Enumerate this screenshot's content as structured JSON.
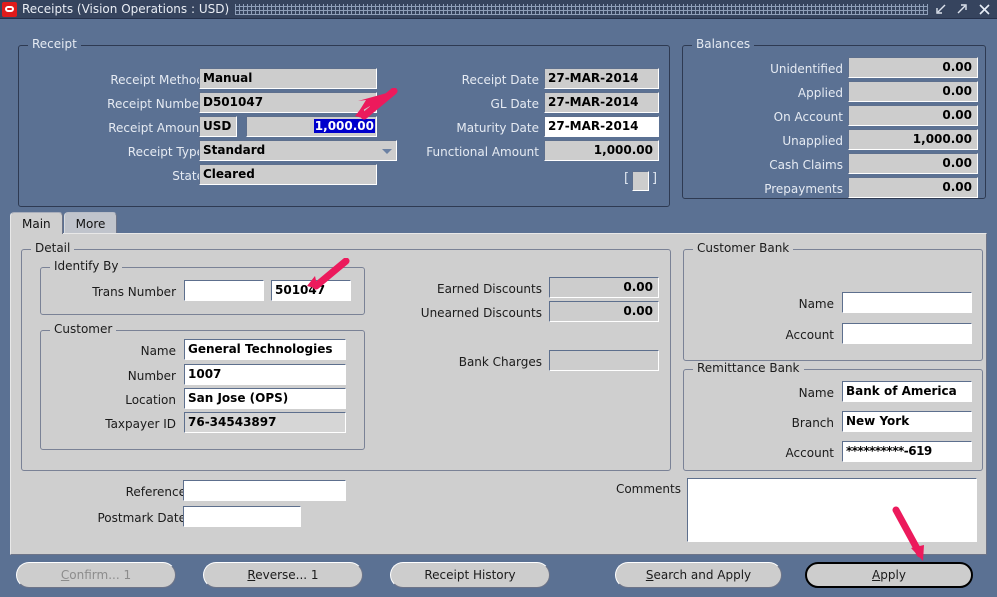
{
  "window": {
    "title": "Receipts (Vision Operations : USD)",
    "logo_icon": "oracle-logo-icon",
    "controls": [
      {
        "name": "minimize-button",
        "icon": "arrow-down-left-icon"
      },
      {
        "name": "maximize-button",
        "icon": "arrow-up-right-icon"
      },
      {
        "name": "close-button",
        "icon": "close-x-icon"
      }
    ]
  },
  "receipt": {
    "legend": "Receipt",
    "fields": {
      "receipt_method_label": "Receipt Method",
      "receipt_method_value": "Manual",
      "receipt_number_label": "Receipt Number",
      "receipt_number_value": "D501047",
      "receipt_amount_label": "Receipt Amount",
      "receipt_currency_value": "USD",
      "receipt_amount_value": "1,000.00",
      "receipt_type_label": "Receipt Type",
      "receipt_type_value": "Standard",
      "state_label": "State",
      "state_value": "Cleared",
      "receipt_date_label": "Receipt Date",
      "receipt_date_value": "27-MAR-2014",
      "gl_date_label": "GL Date",
      "gl_date_value": "27-MAR-2014",
      "maturity_date_label": "Maturity Date",
      "maturity_date_value": "27-MAR-2014",
      "functional_amount_label": "Functional Amount",
      "functional_amount_value": "1,000.00",
      "bracket_open": "[",
      "bracket_close": "]"
    }
  },
  "balances": {
    "legend": "Balances",
    "rows": [
      {
        "label": "Unidentified",
        "value": "0.00"
      },
      {
        "label": "Applied",
        "value": "0.00"
      },
      {
        "label": "On Account",
        "value": "0.00"
      },
      {
        "label": "Unapplied",
        "value": "1,000.00"
      },
      {
        "label": "Cash Claims",
        "value": "0.00"
      },
      {
        "label": "Prepayments",
        "value": "0.00"
      }
    ]
  },
  "tabs": [
    {
      "label": "Main",
      "active": true
    },
    {
      "label": "More",
      "active": false
    }
  ],
  "detail": {
    "legend": "Detail",
    "identify_by": {
      "legend": "Identify By",
      "trans_number_label": "Trans Number",
      "trans_number_value_1": "",
      "trans_number_value_2": "501047"
    },
    "customer": {
      "legend": "Customer",
      "name_label": "Name",
      "name_value": "General Technologies",
      "number_label": "Number",
      "number_value": "1007",
      "location_label": "Location",
      "location_value": "San Jose (OPS)",
      "taxpayer_label": "Taxpayer ID",
      "taxpayer_value": "76-34543897"
    },
    "discounts": {
      "earned_label": "Earned Discounts",
      "earned_value": "0.00",
      "unearned_label": "Unearned Discounts",
      "unearned_value": "0.00",
      "bank_charges_label": "Bank Charges",
      "bank_charges_value": ""
    }
  },
  "customer_bank": {
    "legend": "Customer Bank",
    "name_label": "Name",
    "name_value": "",
    "account_label": "Account",
    "account_value": ""
  },
  "remittance_bank": {
    "legend": "Remittance Bank",
    "name_label": "Name",
    "name_value": "Bank of America",
    "branch_label": "Branch",
    "branch_value": "New York",
    "account_label": "Account",
    "account_value": "**********-619"
  },
  "footer_fields": {
    "reference_label": "Reference",
    "reference_value": "",
    "postmark_label": "Postmark Date",
    "postmark_value": "",
    "comments_label": "Comments",
    "comments_value": ""
  },
  "buttons": [
    {
      "name": "confirm-button",
      "label": "Confirm... 1",
      "mnemonic": "C",
      "before": "",
      "after": "onfirm... 1",
      "disabled": true,
      "focused": false
    },
    {
      "name": "reverse-button",
      "label": "Reverse... 1",
      "mnemonic": "R",
      "before": "",
      "after": "everse... 1",
      "disabled": false,
      "focused": false
    },
    {
      "name": "receipt-history-button",
      "label": "Receipt History",
      "mnemonic": "",
      "before": "Receipt History",
      "after": "",
      "disabled": false,
      "focused": false
    },
    {
      "name": "search-and-apply-button",
      "label": "Search and Apply",
      "mnemonic": "S",
      "before": "",
      "after": "earch and Apply",
      "disabled": false,
      "focused": false
    },
    {
      "name": "apply-button",
      "label": "Apply",
      "mnemonic": "A",
      "before": "",
      "after": "pply",
      "disabled": false,
      "focused": true
    }
  ],
  "annotations": {
    "arrow_color": "#ec1a5c",
    "arrows": [
      {
        "name": "arrow-to-receipt-amount"
      },
      {
        "name": "arrow-to-trans-number"
      },
      {
        "name": "arrow-to-apply-button"
      }
    ]
  }
}
